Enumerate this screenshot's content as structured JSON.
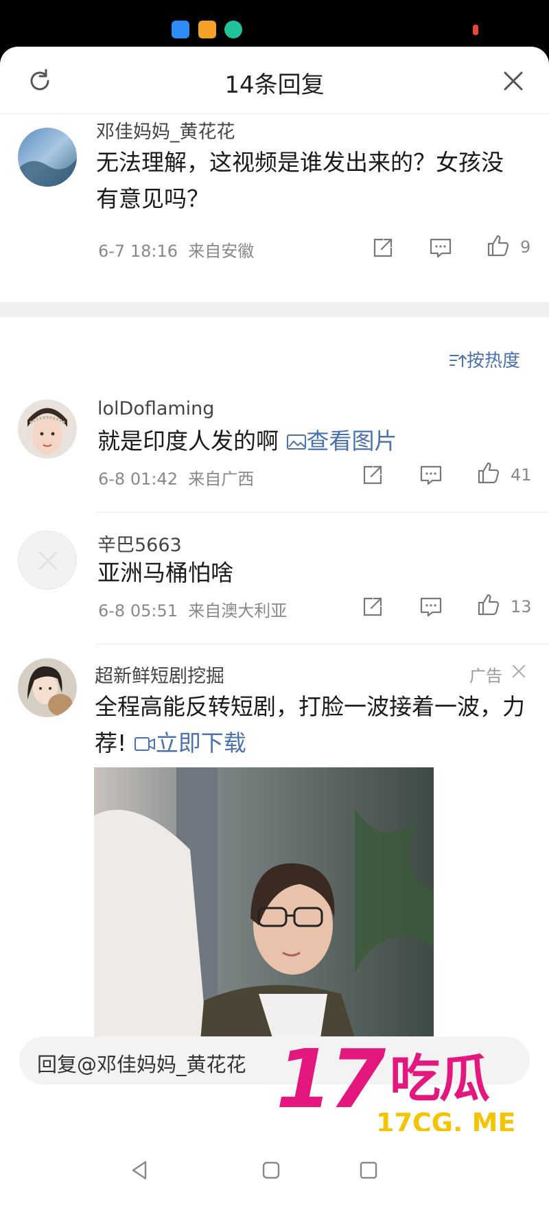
{
  "header": {
    "title": "14条回复"
  },
  "main_comment": {
    "username": "邓佳妈妈_黄花花",
    "text": "无法理解，这视频是谁发出来的？女孩没有意见吗？",
    "date": "6-7 18:16",
    "location": "来自安徽",
    "likes": "9"
  },
  "sort": {
    "label": "按热度"
  },
  "replies": [
    {
      "username": "lolDoflaming",
      "text": "就是印度人发的啊",
      "attachment_label": "查看图片",
      "date": "6-8 01:42",
      "location": "来自广西",
      "likes": "41"
    },
    {
      "username": "辛巴5663",
      "text": "亚洲马桶怕啥",
      "date": "6-8 05:51",
      "location": "来自澳大利亚",
      "likes": "13"
    }
  ],
  "ad": {
    "username": "超新鲜短剧挖掘",
    "label": "广告",
    "text": "全程高能反转短剧，打脸一波接着一波，力荐!",
    "link_label": "立即下载"
  },
  "reply_box": {
    "text": "回复@邓佳妈妈_黄花花"
  },
  "watermark": {
    "big": "17",
    "cn": "吃瓜",
    "url": "17CG. ME"
  },
  "colors": {
    "accent": "#4a72b0",
    "watermark_pink": "#e4177f",
    "watermark_yellow": "#f5c400"
  }
}
